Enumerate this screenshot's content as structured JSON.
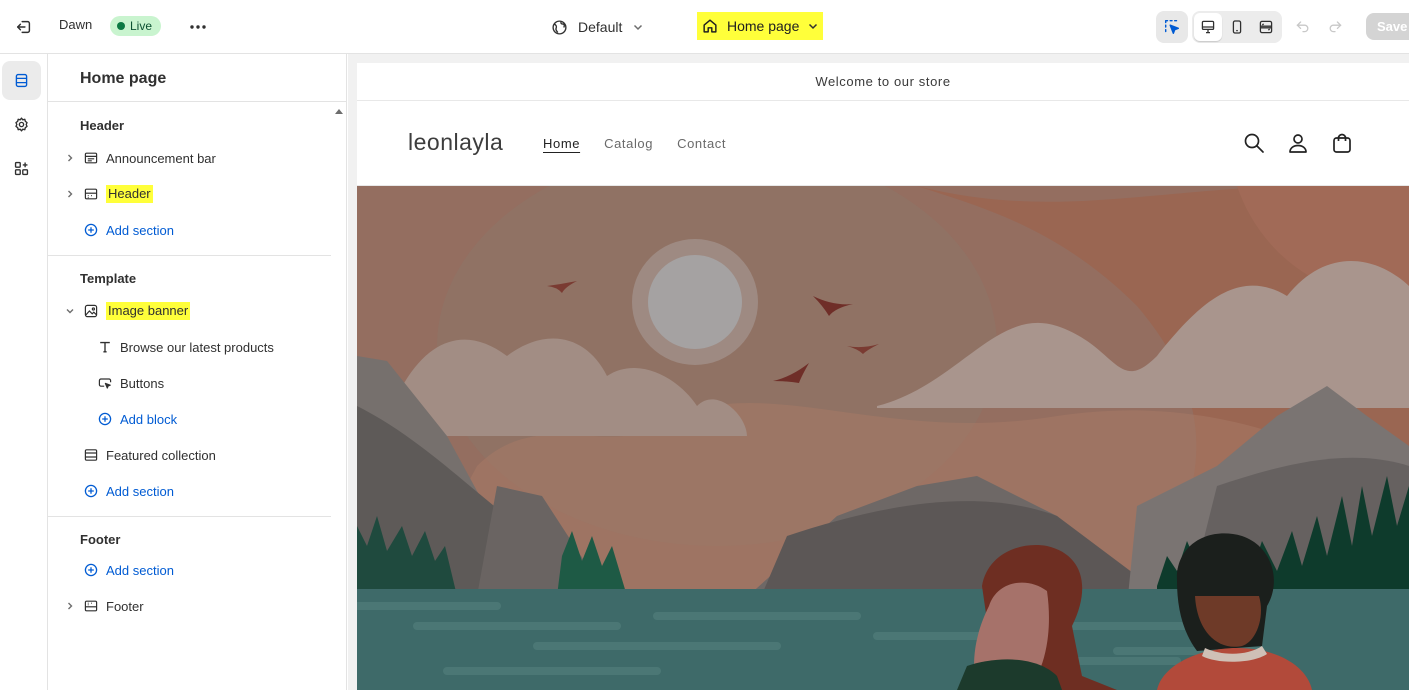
{
  "topbar": {
    "theme_name": "Dawn",
    "live_label": "Live",
    "view_label": "Default",
    "page_selector": "Home page",
    "save_label": "Save"
  },
  "sidebar": {
    "title": "Home page",
    "header_group": {
      "label": "Header",
      "items": [
        {
          "label": "Announcement bar"
        },
        {
          "label": "Header"
        }
      ],
      "add_label": "Add section"
    },
    "template_group": {
      "label": "Template",
      "image_banner": "Image banner",
      "blocks": [
        {
          "label": "Browse our latest products"
        },
        {
          "label": "Buttons"
        }
      ],
      "add_block_label": "Add block",
      "featured": "Featured collection",
      "add_label": "Add section"
    },
    "footer_group": {
      "label": "Footer",
      "add_label": "Add section",
      "footer_item": "Footer"
    }
  },
  "preview": {
    "announcement": "Welcome to our store",
    "logo": "leonlayla",
    "nav": [
      "Home",
      "Catalog",
      "Contact"
    ]
  },
  "colors": {
    "highlight": "#ffff3a",
    "accent_blue": "#005bd3",
    "live_bg": "#c9f4cf"
  }
}
